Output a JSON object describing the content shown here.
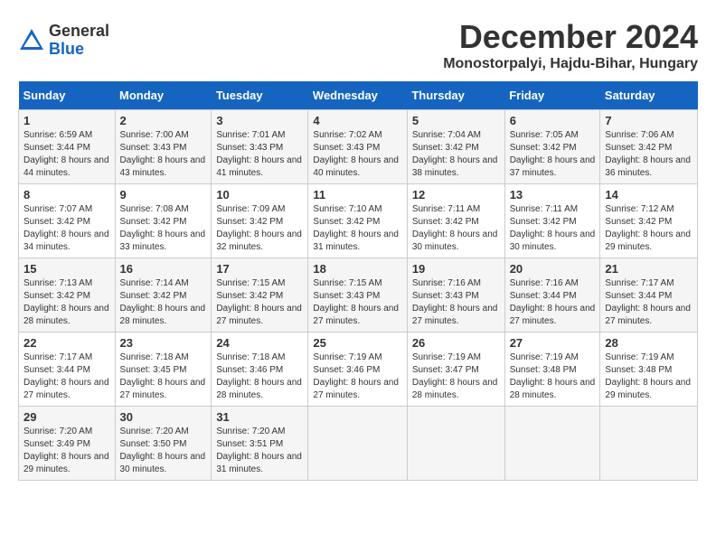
{
  "logo": {
    "general": "General",
    "blue": "Blue"
  },
  "title": {
    "month": "December 2024",
    "location": "Monostorpalyi, Hajdu-Bihar, Hungary"
  },
  "days_of_week": [
    "Sunday",
    "Monday",
    "Tuesday",
    "Wednesday",
    "Thursday",
    "Friday",
    "Saturday"
  ],
  "weeks": [
    [
      {
        "day": "1",
        "sunrise": "6:59 AM",
        "sunset": "3:44 PM",
        "daylight": "8 hours and 44 minutes."
      },
      {
        "day": "2",
        "sunrise": "7:00 AM",
        "sunset": "3:43 PM",
        "daylight": "8 hours and 43 minutes."
      },
      {
        "day": "3",
        "sunrise": "7:01 AM",
        "sunset": "3:43 PM",
        "daylight": "8 hours and 41 minutes."
      },
      {
        "day": "4",
        "sunrise": "7:02 AM",
        "sunset": "3:43 PM",
        "daylight": "8 hours and 40 minutes."
      },
      {
        "day": "5",
        "sunrise": "7:04 AM",
        "sunset": "3:42 PM",
        "daylight": "8 hours and 38 minutes."
      },
      {
        "day": "6",
        "sunrise": "7:05 AM",
        "sunset": "3:42 PM",
        "daylight": "8 hours and 37 minutes."
      },
      {
        "day": "7",
        "sunrise": "7:06 AM",
        "sunset": "3:42 PM",
        "daylight": "8 hours and 36 minutes."
      }
    ],
    [
      {
        "day": "8",
        "sunrise": "7:07 AM",
        "sunset": "3:42 PM",
        "daylight": "8 hours and 34 minutes."
      },
      {
        "day": "9",
        "sunrise": "7:08 AM",
        "sunset": "3:42 PM",
        "daylight": "8 hours and 33 minutes."
      },
      {
        "day": "10",
        "sunrise": "7:09 AM",
        "sunset": "3:42 PM",
        "daylight": "8 hours and 32 minutes."
      },
      {
        "day": "11",
        "sunrise": "7:10 AM",
        "sunset": "3:42 PM",
        "daylight": "8 hours and 31 minutes."
      },
      {
        "day": "12",
        "sunrise": "7:11 AM",
        "sunset": "3:42 PM",
        "daylight": "8 hours and 30 minutes."
      },
      {
        "day": "13",
        "sunrise": "7:11 AM",
        "sunset": "3:42 PM",
        "daylight": "8 hours and 30 minutes."
      },
      {
        "day": "14",
        "sunrise": "7:12 AM",
        "sunset": "3:42 PM",
        "daylight": "8 hours and 29 minutes."
      }
    ],
    [
      {
        "day": "15",
        "sunrise": "7:13 AM",
        "sunset": "3:42 PM",
        "daylight": "8 hours and 28 minutes."
      },
      {
        "day": "16",
        "sunrise": "7:14 AM",
        "sunset": "3:42 PM",
        "daylight": "8 hours and 28 minutes."
      },
      {
        "day": "17",
        "sunrise": "7:15 AM",
        "sunset": "3:42 PM",
        "daylight": "8 hours and 27 minutes."
      },
      {
        "day": "18",
        "sunrise": "7:15 AM",
        "sunset": "3:43 PM",
        "daylight": "8 hours and 27 minutes."
      },
      {
        "day": "19",
        "sunrise": "7:16 AM",
        "sunset": "3:43 PM",
        "daylight": "8 hours and 27 minutes."
      },
      {
        "day": "20",
        "sunrise": "7:16 AM",
        "sunset": "3:44 PM",
        "daylight": "8 hours and 27 minutes."
      },
      {
        "day": "21",
        "sunrise": "7:17 AM",
        "sunset": "3:44 PM",
        "daylight": "8 hours and 27 minutes."
      }
    ],
    [
      {
        "day": "22",
        "sunrise": "7:17 AM",
        "sunset": "3:44 PM",
        "daylight": "8 hours and 27 minutes."
      },
      {
        "day": "23",
        "sunrise": "7:18 AM",
        "sunset": "3:45 PM",
        "daylight": "8 hours and 27 minutes."
      },
      {
        "day": "24",
        "sunrise": "7:18 AM",
        "sunset": "3:46 PM",
        "daylight": "8 hours and 28 minutes."
      },
      {
        "day": "25",
        "sunrise": "7:19 AM",
        "sunset": "3:46 PM",
        "daylight": "8 hours and 27 minutes."
      },
      {
        "day": "26",
        "sunrise": "7:19 AM",
        "sunset": "3:47 PM",
        "daylight": "8 hours and 28 minutes."
      },
      {
        "day": "27",
        "sunrise": "7:19 AM",
        "sunset": "3:48 PM",
        "daylight": "8 hours and 28 minutes."
      },
      {
        "day": "28",
        "sunrise": "7:19 AM",
        "sunset": "3:48 PM",
        "daylight": "8 hours and 29 minutes."
      }
    ],
    [
      {
        "day": "29",
        "sunrise": "7:20 AM",
        "sunset": "3:49 PM",
        "daylight": "8 hours and 29 minutes."
      },
      {
        "day": "30",
        "sunrise": "7:20 AM",
        "sunset": "3:50 PM",
        "daylight": "8 hours and 30 minutes."
      },
      {
        "day": "31",
        "sunrise": "7:20 AM",
        "sunset": "3:51 PM",
        "daylight": "8 hours and 31 minutes."
      },
      null,
      null,
      null,
      null
    ]
  ]
}
